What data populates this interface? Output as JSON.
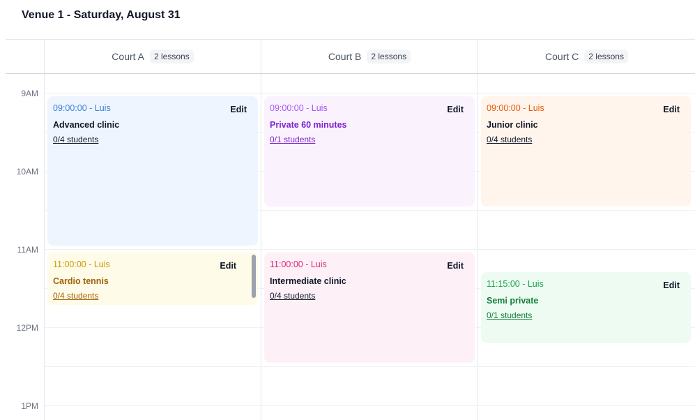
{
  "title": "Venue 1 - Saturday, August 31",
  "columns": [
    {
      "name": "Court A",
      "badge": "2 lessons"
    },
    {
      "name": "Court B",
      "badge": "2 lessons"
    },
    {
      "name": "Court C",
      "badge": "2 lessons"
    }
  ],
  "times": [
    "9AM",
    "10AM",
    "11AM",
    "12PM",
    "1PM"
  ],
  "edit_label": "Edit",
  "events": [
    {
      "court": "Court A",
      "time": "09:00:00 - Luis",
      "title": "Advanced clinic",
      "students": "0/4 students",
      "bg": "#eef5fe",
      "accent": "#3b7fd8"
    },
    {
      "court": "Court A",
      "time": "11:00:00 - Luis",
      "title": "Cardio tennis",
      "students": "0/4 students",
      "bg": "#fefbe8",
      "accent": "#a26a06"
    },
    {
      "court": "Court B",
      "time": "09:00:00 - Luis",
      "title": "Private 60 minutes",
      "students": "0/1 students",
      "bg": "#faf3fe",
      "accent": "#9333ea"
    },
    {
      "court": "Court B",
      "time": "11:00:00 - Luis",
      "title": "Intermediate clinic",
      "students": "0/4 students",
      "bg": "#fdf1f7",
      "accent": "#db2777"
    },
    {
      "court": "Court C",
      "time": "09:00:00 - Luis",
      "title": "Junior clinic",
      "students": "0/4 students",
      "bg": "#fff5ec",
      "accent": "#ea580c"
    },
    {
      "court": "Court C",
      "time": "11:15:00 - Luis",
      "title": "Semi private",
      "students": "0/1 students",
      "bg": "#eefbf2",
      "accent": "#16a34a"
    }
  ]
}
